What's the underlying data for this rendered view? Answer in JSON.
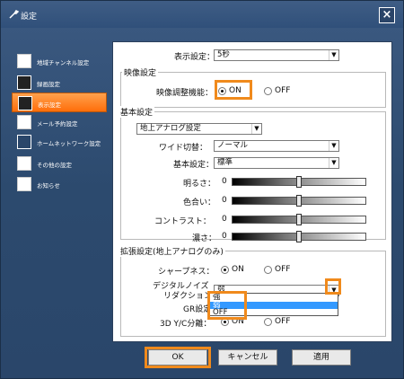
{
  "window": {
    "title": "設定",
    "close_label": "×"
  },
  "sidebar": {
    "items": [
      {
        "label": "地域チャンネル設定",
        "icon": "satellite-icon"
      },
      {
        "label": "録画設定",
        "icon": "record-icon"
      },
      {
        "label": "表示設定",
        "icon": "display-icon",
        "active": true
      },
      {
        "label": "メール予約設定",
        "icon": "mail-icon"
      },
      {
        "label": "ホームネットワーク設定",
        "icon": "network-icon"
      },
      {
        "label": "その他の設定",
        "icon": "wrench-icon"
      },
      {
        "label": "お知らせ",
        "icon": "info-icon"
      }
    ]
  },
  "display": {
    "label": "表示設定：",
    "value": "5秒"
  },
  "video": {
    "section_title": "映像設定",
    "adjust_label": "映像調整機能：",
    "on_label": "ON",
    "off_label": "OFF",
    "selected": "ON"
  },
  "basic": {
    "section_title": "基本設定",
    "source_value": "地上アナログ設定",
    "wide_label": "ワイド切替：",
    "wide_value": "ノーマル",
    "basic_label": "基本設定：",
    "basic_value": "標準",
    "sliders": [
      {
        "label": "明るさ：",
        "value": "0",
        "level": 0.5
      },
      {
        "label": "色合い：",
        "value": "0",
        "level": 0.5
      },
      {
        "label": "コントラスト：",
        "value": "0",
        "level": 0.5
      },
      {
        "label": "濃さ：",
        "value": "0",
        "level": 0.5
      }
    ]
  },
  "extended": {
    "section_title": "拡張設定(地上アナログのみ)",
    "sharpness_label": "シャープネス：",
    "sharpness_on": "ON",
    "sharpness_off": "OFF",
    "noise_label_1": "デジタルノイズ",
    "noise_label_2": "リダクション：",
    "noise_value": "弱",
    "noise_options": [
      "強",
      "弱",
      "OFF"
    ],
    "noise_selected_index": 1,
    "gr_label": "GR設定：",
    "yc_label": "3D Y/C分離：",
    "yc_on": "ON",
    "yc_off": "OFF"
  },
  "buttons": {
    "ok": "OK",
    "cancel": "キャンセル",
    "apply": "適用"
  },
  "colors": {
    "accent": "#f08a1c",
    "sidebar_active": "#ff7a14",
    "dropdown_selected": "#3399ff"
  }
}
